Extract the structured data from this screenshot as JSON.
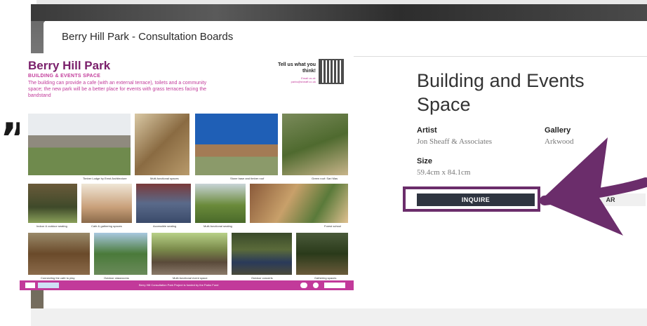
{
  "modal": {
    "title": "Berry Hill Park - Consultation Boards"
  },
  "poster": {
    "title": "Berry Hill Park",
    "subtitle": "BUILDING & EVENTS SPACE",
    "description": "The building can provide a cafe (with an external terrace), toilets and a community space; the new park will be a better place for events with grass terraces facing the bandstand",
    "cta": "Tell us what you think!",
    "email": "Email us at: parks@sheaff.co.uk",
    "captions": [
      "Timber Lodge by Ernst Architecture",
      "Multi-functional spaces",
      "Stone base and timber roof",
      "Green roof: Sari Mas",
      "Indoor & outdoor seating",
      "Cafe & gathering spaces",
      "Accessible seating",
      "Multi-functional seating",
      "Forest school",
      "Connecting the cafe to play",
      "Outdoor classrooms",
      "Multi-functional event space",
      "Outdoor concerts",
      "Gathering spaces"
    ],
    "footer": "Berry Hill Consultation Park Project is funded by the Parks Fund"
  },
  "artwork": {
    "title": "Building and Events Space",
    "artist_label": "Artist",
    "artist": "Jon Sheaff & Associates",
    "gallery_label": "Gallery",
    "gallery": "Arkwood",
    "size_label": "Size",
    "size": "59.4cm x 84.1cm"
  },
  "actions": {
    "inquire": "INQUIRE",
    "ar": "AR"
  },
  "decor": {
    "quote_mark": "”"
  },
  "colors": {
    "accent": "#6b2d6b",
    "button": "#2e3440",
    "poster_pink": "#c23a9a"
  }
}
